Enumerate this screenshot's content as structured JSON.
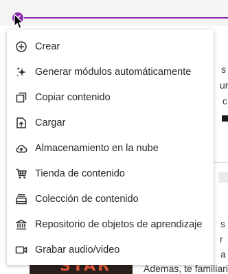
{
  "menu": {
    "items": [
      {
        "label": "Crear",
        "icon": "plus-circle-icon"
      },
      {
        "label": "Generar módulos automáticamente",
        "icon": "sparkle-icon"
      },
      {
        "label": "Copiar contenido",
        "icon": "copy-icon"
      },
      {
        "label": "Cargar",
        "icon": "upload-icon"
      },
      {
        "label": "Almacenamiento en la nube",
        "icon": "cloud-upload-icon"
      },
      {
        "label": "Tienda de contenido",
        "icon": "cart-icon"
      },
      {
        "label": "Colección de contenido",
        "icon": "collection-icon"
      },
      {
        "label": "Repositorio de objetos de aprendizaje",
        "icon": "institution-icon"
      },
      {
        "label": "Grabar audio/video",
        "icon": "video-camera-icon"
      }
    ]
  },
  "background": {
    "peek_texts": [
      "s",
      "ur",
      "c",
      "s",
      "r",
      "a",
      "Ademas, te familiari"
    ],
    "image_text": "STAR"
  },
  "colors": {
    "accent": "#8b2bb0",
    "menu_bg": "#ffffff",
    "text": "#262626"
  }
}
